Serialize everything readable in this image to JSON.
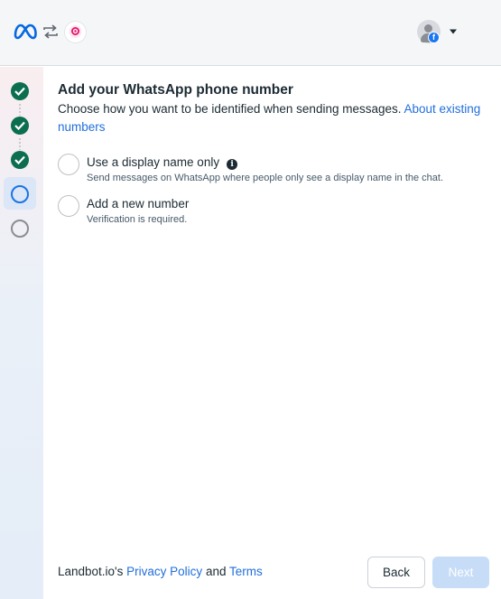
{
  "header": {
    "logo_icon": "meta-logo-icon",
    "sync_icon": "sync-arrows-icon",
    "app_icon": "landbot-logo-icon",
    "avatar_badge": "f",
    "dropdown_icon": "caret-down-icon"
  },
  "steps": [
    {
      "state": "done"
    },
    {
      "state": "done"
    },
    {
      "state": "done"
    },
    {
      "state": "current"
    },
    {
      "state": "todo"
    }
  ],
  "main": {
    "title": "Add your WhatsApp phone number",
    "subtitle": "Choose how you want to be identified when sending messages.",
    "subtitle_link": "About existing numbers",
    "options": [
      {
        "label": "Use a display name only",
        "description": "Send messages on WhatsApp where people only see a display name in the chat.",
        "has_info": true,
        "selected": false
      },
      {
        "label": "Add a new number",
        "description": "Verification is required.",
        "has_info": false,
        "selected": false
      }
    ]
  },
  "footer": {
    "company": "Landbot.io's",
    "privacy_link": "Privacy Policy",
    "and": "and",
    "terms_link": "Terms",
    "back_label": "Back",
    "next_label": "Next"
  },
  "colors": {
    "accent": "#1877f2",
    "done_step": "#0b6e4f",
    "link": "#216fdb",
    "next_disabled": "#c7ddf7"
  }
}
